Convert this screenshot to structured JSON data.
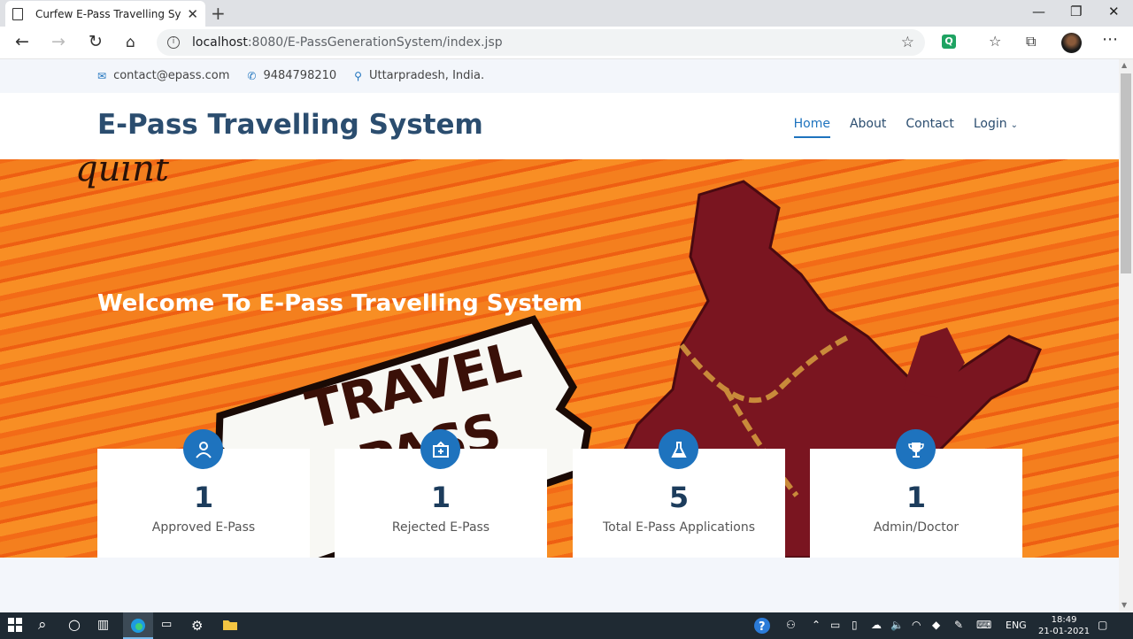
{
  "browser": {
    "tab_title": "Curfew E-Pass Travelling System",
    "url_host": "localhost",
    "url_path": ":8080/E-PassGenerationSystem/index.jsp"
  },
  "site": {
    "contact": {
      "email": "contact@epass.com",
      "phone": "9484798210",
      "location": "Uttarpradesh, India."
    },
    "brand": "E-Pass Travelling System",
    "nav": [
      {
        "label": "Home",
        "active": true
      },
      {
        "label": "About"
      },
      {
        "label": "Contact"
      },
      {
        "label": "Login"
      }
    ],
    "hero": {
      "headline": "Welcome To E-Pass Travelling System",
      "image_text": [
        "TRAVEL",
        "PASS"
      ],
      "corner_text": "quint"
    },
    "stats": [
      {
        "value": "1",
        "label": "Approved E-Pass",
        "icon": "doctor-icon"
      },
      {
        "value": "1",
        "label": "Rejected E-Pass",
        "icon": "hospital-icon"
      },
      {
        "value": "5",
        "label": "Total E-Pass Applications",
        "icon": "flask-icon"
      },
      {
        "value": "1",
        "label": "Admin/Doctor",
        "icon": "trophy-icon"
      }
    ]
  },
  "taskbar": {
    "lang": "ENG",
    "time": "18:49",
    "date": "21-01-2021"
  }
}
